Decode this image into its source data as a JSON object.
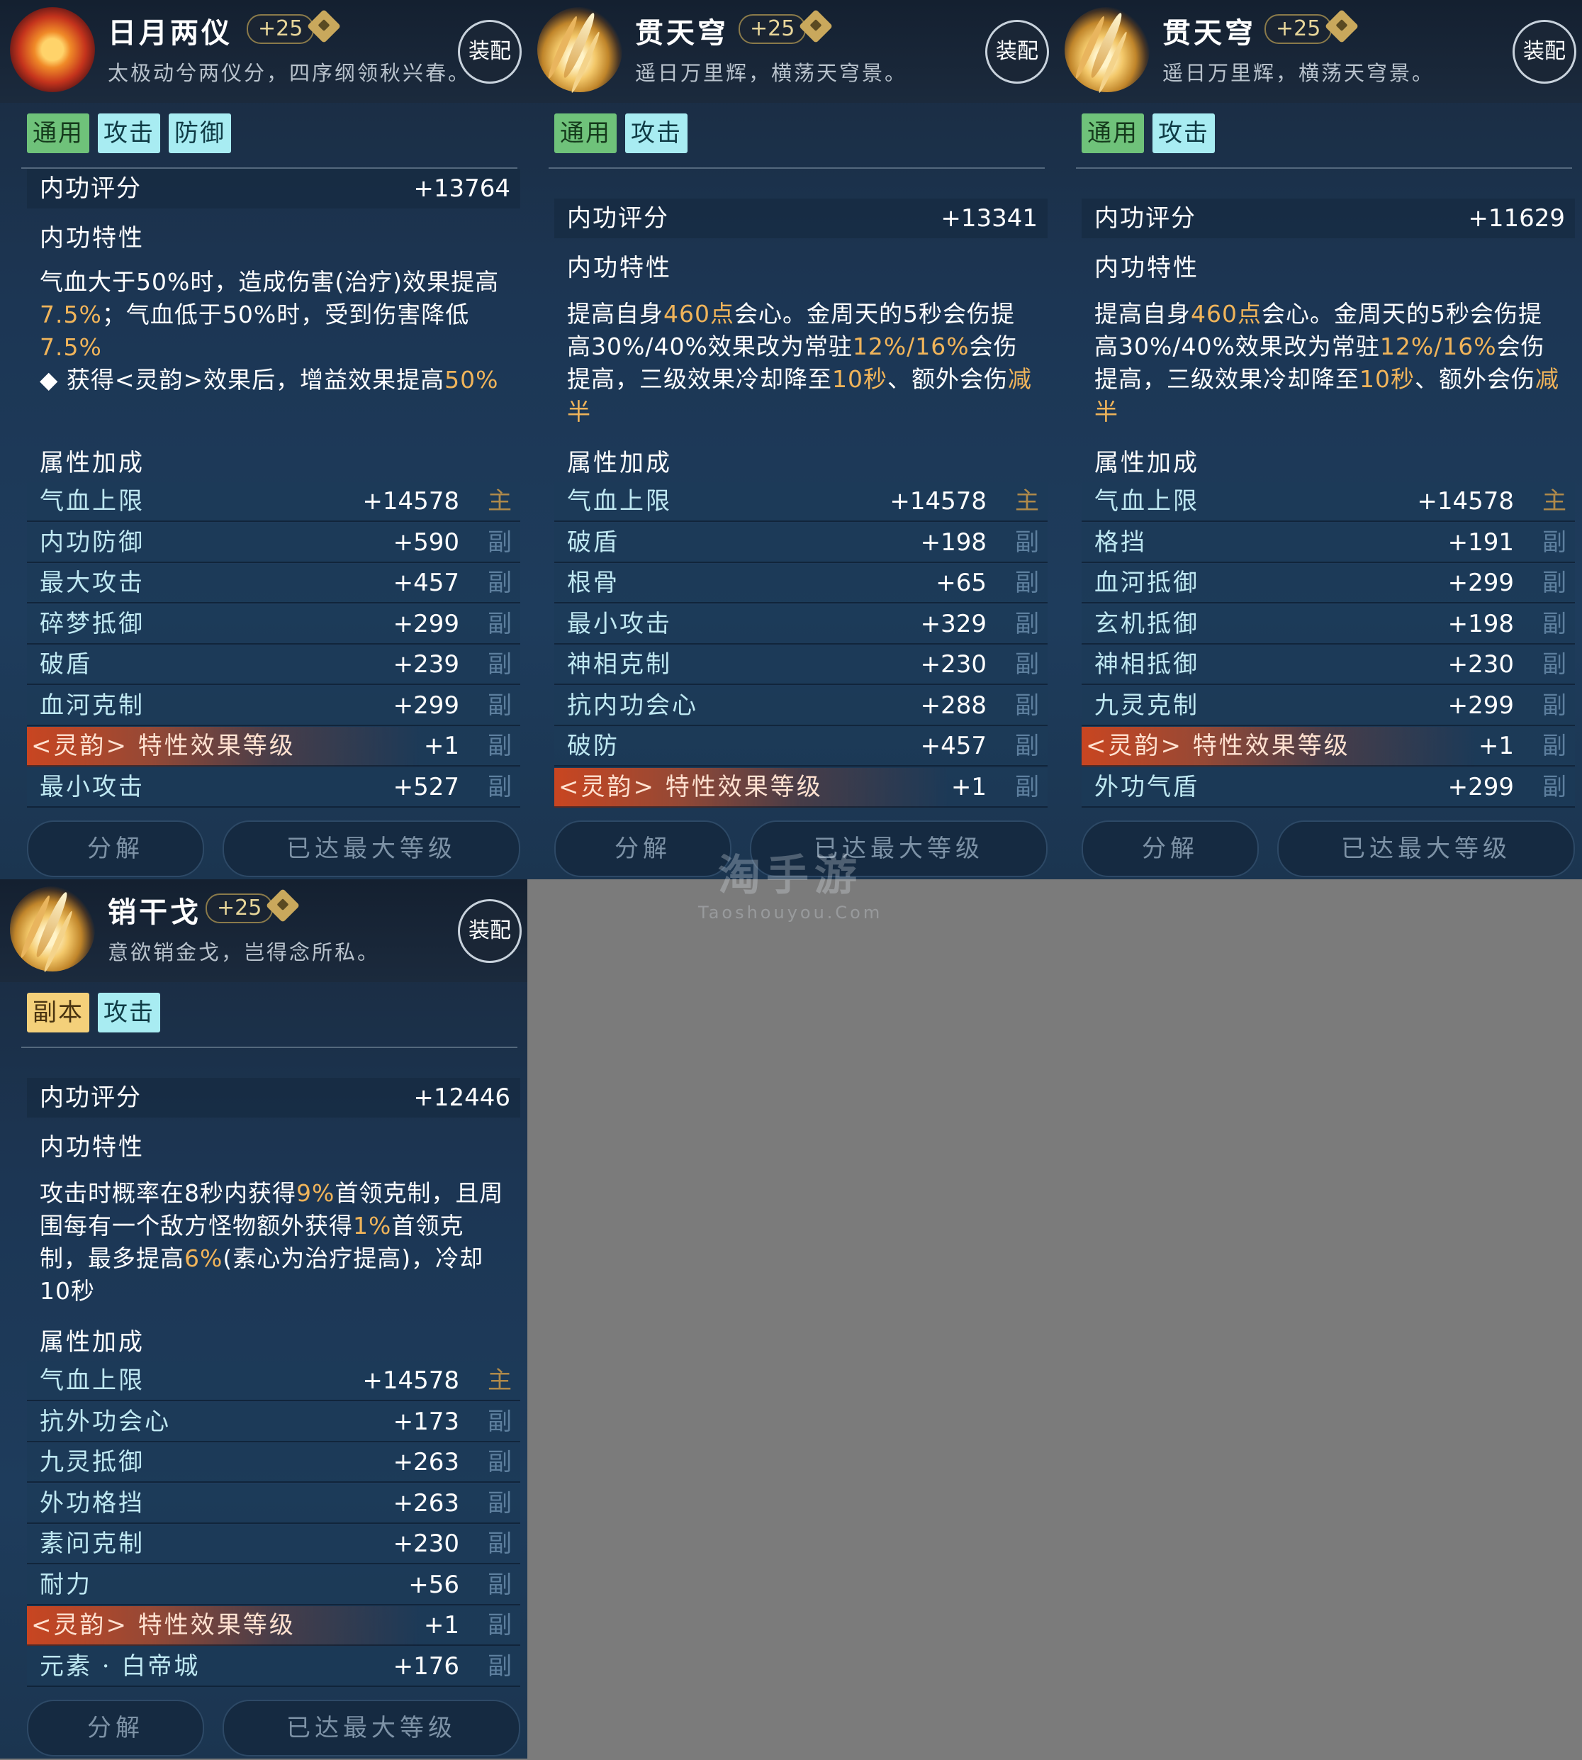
{
  "watermark": {
    "text": "淘手游",
    "sub": "Taoshouyou.Com"
  },
  "ui": {
    "equip_label": "装配",
    "decompose_label": "分解",
    "maxlevel_label": "已达最大等级",
    "score_label": "内功评分",
    "trait_label": "内功特性",
    "attr_label": "属性加成",
    "main_tag": "主",
    "sub_tag": "副"
  },
  "cards": [
    {
      "name": "日月两仪",
      "level": "+25",
      "motto": "太极动兮两仪分，四序纲领秋兴春。",
      "emblem": "sun-emblem-icon",
      "tags": [
        {
          "text": "通用",
          "style": "green"
        },
        {
          "text": "攻击",
          "style": "cyan"
        },
        {
          "text": "防御",
          "style": "cyan"
        }
      ],
      "score": "+13764",
      "desc": [
        [
          "气血大于50%时，造成伤害(治疗)效果提高",
          ""
        ],
        [
          "7.5%",
          "hl"
        ],
        [
          "；气血低于50%时，受到伤害降低",
          ""
        ],
        [
          "7.5%",
          "hl"
        ],
        [
          "\n◆ 获得<灵韵>效果后，增益效果提高",
          ""
        ],
        [
          "50%",
          "hl"
        ]
      ],
      "attrs": [
        {
          "name": "气血上限",
          "value": "+14578",
          "type": "main"
        },
        {
          "name": "内功防御",
          "value": "+590",
          "type": "sub"
        },
        {
          "name": "最大攻击",
          "value": "+457",
          "type": "sub"
        },
        {
          "name": "碎梦抵御",
          "value": "+299",
          "type": "sub"
        },
        {
          "name": "破盾",
          "value": "+239",
          "type": "sub"
        },
        {
          "name": "血河克制",
          "value": "+299",
          "type": "sub"
        },
        {
          "name": "<灵韵> 特性效果等级",
          "value": "+1",
          "type": "sub",
          "special": true
        },
        {
          "name": "最小攻击",
          "value": "+527",
          "type": "sub"
        }
      ]
    },
    {
      "name": "贯天穹",
      "level": "+25",
      "motto": "遥日万里辉，横荡天穹景。",
      "emblem": "blade-emblem-icon",
      "tags": [
        {
          "text": "通用",
          "style": "green"
        },
        {
          "text": "攻击",
          "style": "cyan"
        }
      ],
      "score": "+13341",
      "desc": [
        [
          "提高自身",
          ""
        ],
        [
          "460点",
          "hl"
        ],
        [
          "会心。金周天的5秒会伤提高30%/40%效果改为常驻",
          ""
        ],
        [
          "12%/16%",
          "hl"
        ],
        [
          "会伤提高，三级效果冷却降至",
          ""
        ],
        [
          "10秒",
          "hl"
        ],
        [
          "、额外会伤",
          ""
        ],
        [
          "减半",
          "hl"
        ]
      ],
      "attrs": [
        {
          "name": "气血上限",
          "value": "+14578",
          "type": "main"
        },
        {
          "name": "破盾",
          "value": "+198",
          "type": "sub"
        },
        {
          "name": "根骨",
          "value": "+65",
          "type": "sub"
        },
        {
          "name": "最小攻击",
          "value": "+329",
          "type": "sub"
        },
        {
          "name": "神相克制",
          "value": "+230",
          "type": "sub"
        },
        {
          "name": "抗内功会心",
          "value": "+288",
          "type": "sub"
        },
        {
          "name": "破防",
          "value": "+457",
          "type": "sub"
        },
        {
          "name": "<灵韵> 特性效果等级",
          "value": "+1",
          "type": "sub",
          "special": true
        }
      ]
    },
    {
      "name": "贯天穹",
      "level": "+25",
      "motto": "遥日万里辉，横荡天穹景。",
      "emblem": "blade-emblem-icon",
      "tags": [
        {
          "text": "通用",
          "style": "green"
        },
        {
          "text": "攻击",
          "style": "cyan"
        }
      ],
      "score": "+11629",
      "desc": [
        [
          "提高自身",
          ""
        ],
        [
          "460点",
          "hl"
        ],
        [
          "会心。金周天的5秒会伤提高30%/40%效果改为常驻",
          ""
        ],
        [
          "12%/16%",
          "hl"
        ],
        [
          "会伤提高，三级效果冷却降至",
          ""
        ],
        [
          "10秒",
          "hl"
        ],
        [
          "、额外会伤",
          ""
        ],
        [
          "减半",
          "hl"
        ]
      ],
      "attrs": [
        {
          "name": "气血上限",
          "value": "+14578",
          "type": "main"
        },
        {
          "name": "格挡",
          "value": "+191",
          "type": "sub"
        },
        {
          "name": "血河抵御",
          "value": "+299",
          "type": "sub"
        },
        {
          "name": "玄机抵御",
          "value": "+198",
          "type": "sub"
        },
        {
          "name": "神相抵御",
          "value": "+230",
          "type": "sub"
        },
        {
          "name": "九灵克制",
          "value": "+299",
          "type": "sub"
        },
        {
          "name": "<灵韵> 特性效果等级",
          "value": "+1",
          "type": "sub",
          "special": true
        },
        {
          "name": "外功气盾",
          "value": "+299",
          "type": "sub"
        }
      ]
    },
    {
      "name": "销干戈",
      "level": "+25",
      "motto": "意欲销金戈，岂得念所私。",
      "emblem": "blade-emblem-icon",
      "tags": [
        {
          "text": "副本",
          "style": "yellow"
        },
        {
          "text": "攻击",
          "style": "cyan"
        }
      ],
      "score": "+12446",
      "desc": [
        [
          "攻击时概率在8秒内获得",
          ""
        ],
        [
          "9%",
          "hl"
        ],
        [
          "首领克制，且周围每有一个敌方怪物额外获得",
          ""
        ],
        [
          "1%",
          "hl"
        ],
        [
          "首领克制，最多提高",
          ""
        ],
        [
          "6%",
          "hl"
        ],
        [
          "(素心为治疗提高)，冷却10秒",
          ""
        ]
      ],
      "attrs": [
        {
          "name": "气血上限",
          "value": "+14578",
          "type": "main"
        },
        {
          "name": "抗外功会心",
          "value": "+173",
          "type": "sub"
        },
        {
          "name": "九灵抵御",
          "value": "+263",
          "type": "sub"
        },
        {
          "name": "外功格挡",
          "value": "+263",
          "type": "sub"
        },
        {
          "name": "素问克制",
          "value": "+230",
          "type": "sub"
        },
        {
          "name": "耐力",
          "value": "+56",
          "type": "sub"
        },
        {
          "name": "<灵韵> 特性效果等级",
          "value": "+1",
          "type": "sub",
          "special": true
        },
        {
          "name": "元素 · 白帝城",
          "value": "+176",
          "type": "sub"
        }
      ]
    }
  ]
}
